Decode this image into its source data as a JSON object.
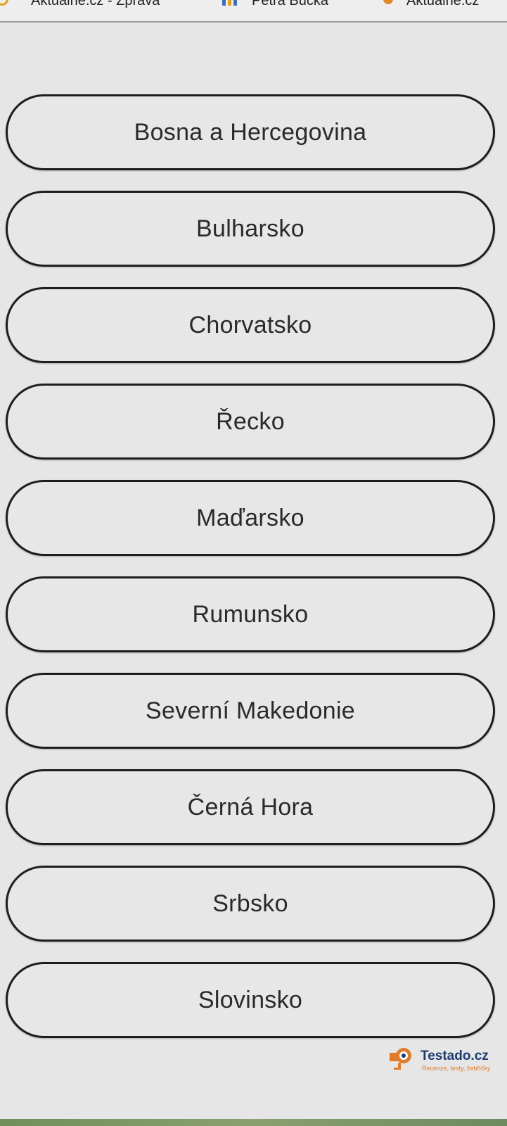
{
  "top_bar": {
    "items": [
      {
        "label": "Aktuálně.cz - Zpráva",
        "icon": "face-icon"
      },
      {
        "label": "Petra Bučka",
        "icon": "bar-chart-icon"
      },
      {
        "label": "Aktuálně.cz",
        "icon": "pin-icon"
      }
    ]
  },
  "countries": [
    "Bosna a Hercegovina",
    "Bulharsko",
    "Chorvatsko",
    "Řecko",
    "Maďarsko",
    "Rumunsko",
    "Severní Makedonie",
    "Černá Hora",
    "Srbsko",
    "Slovinsko"
  ],
  "watermark": {
    "title": "Testado.cz",
    "tagline": "Recenze, testy, žebříčky"
  },
  "colors": {
    "background": "#e6e6e6",
    "button_border": "#1e1e1e",
    "brand_navy": "#1c3c6e",
    "brand_orange": "#e07b2a"
  }
}
